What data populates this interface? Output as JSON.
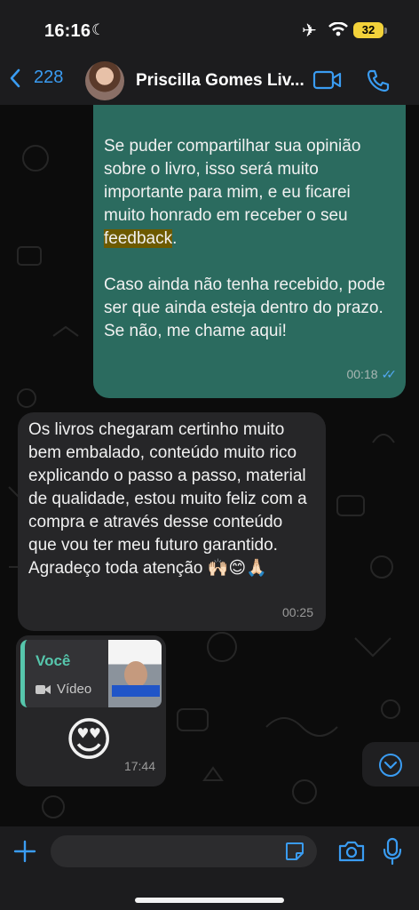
{
  "status_bar": {
    "time": "16:16",
    "battery": "32"
  },
  "header": {
    "back_count": "228",
    "contact_name": "Priscilla Gomes Liv..."
  },
  "messages": {
    "outgoing": {
      "paragraph1_before": "Se puder compartilhar sua opinião sobre o livro, isso será muito importante para mim, e eu ficarei muito honrado em receber o seu ",
      "paragraph1_highlight": "feedback",
      "paragraph1_after": ".",
      "paragraph2": "Caso ainda não tenha recebido, pode ser que ainda esteja dentro do prazo. Se não, me chame aqui!",
      "time": "00:18"
    },
    "incoming1": {
      "text": "Os livros chegaram certinho muito bem embalado, conteúdo muito rico explicando o passo a passo, material de qualidade, estou muito feliz com a compra e através desse conteúdo que vou ter meu futuro garantido.",
      "text2": "Agradeço toda atenção 🙌🏻😊🙏🏻",
      "time": "00:25"
    },
    "incoming2": {
      "quote_author": "Você",
      "quote_type": "Vídeo",
      "emoji": "😍",
      "time": "17:44"
    }
  },
  "colors": {
    "accent": "#3a9cf2",
    "outgoing_bubble": "#2b6b5f",
    "incoming_bubble": "#262628",
    "quote_accent": "#56c6ac",
    "highlight": "#6d5a00"
  }
}
